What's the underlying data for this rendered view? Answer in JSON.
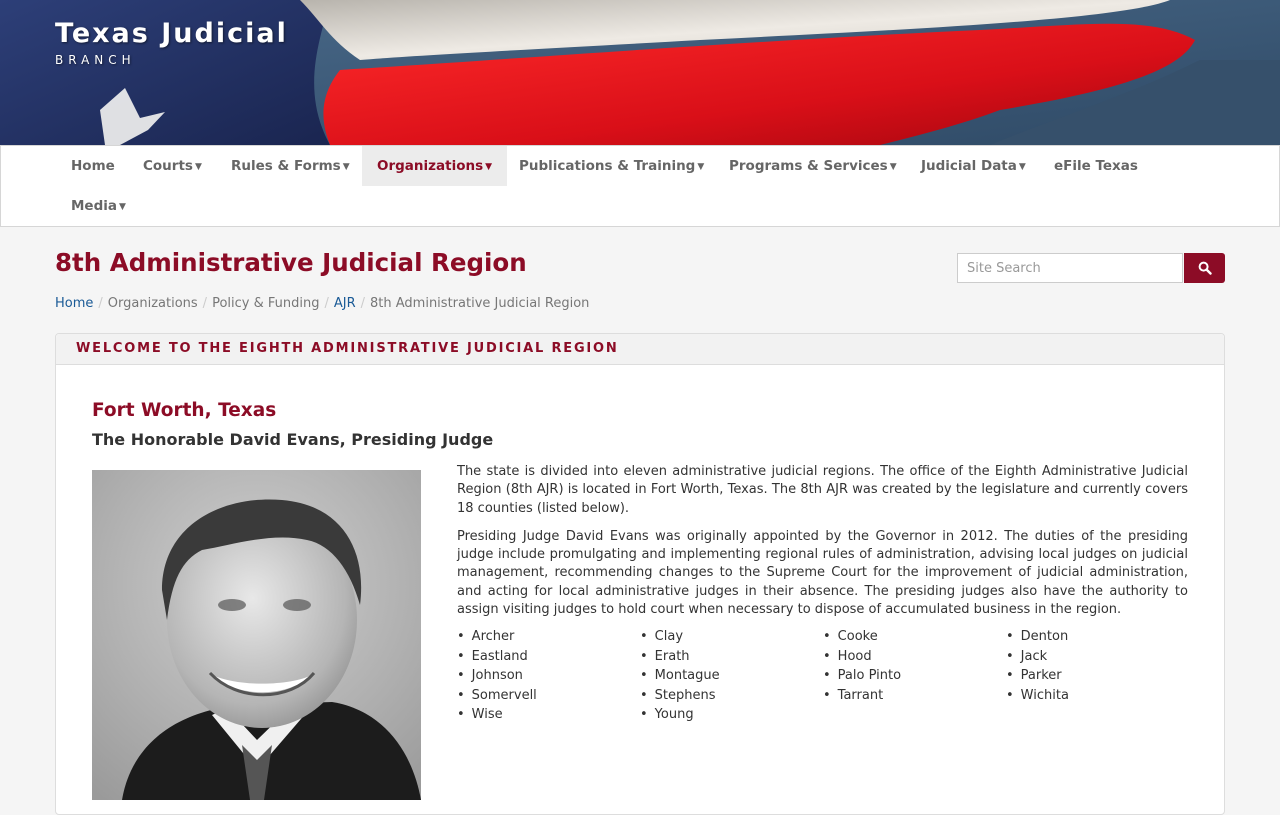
{
  "brand": {
    "title": "Texas Judicial",
    "subtitle": "BRANCH"
  },
  "nav": {
    "items": [
      {
        "label": "Home",
        "dropdown": false
      },
      {
        "label": "Courts",
        "dropdown": true
      },
      {
        "label": "Rules & Forms",
        "dropdown": true
      },
      {
        "label": "Organizations",
        "dropdown": true,
        "active": true
      },
      {
        "label": "Publications & Training",
        "dropdown": true
      },
      {
        "label": "Programs & Services",
        "dropdown": true
      },
      {
        "label": "Judicial Data",
        "dropdown": true
      },
      {
        "label": "eFile Texas",
        "dropdown": false
      },
      {
        "label": "Media",
        "dropdown": true
      }
    ]
  },
  "page": {
    "title": "8th Administrative Judicial Region"
  },
  "search": {
    "placeholder": "Site Search",
    "icon": "search-icon"
  },
  "breadcrumb": [
    {
      "label": "Home",
      "link": true
    },
    {
      "label": "Organizations",
      "link": false
    },
    {
      "label": "Policy & Funding",
      "link": false
    },
    {
      "label": "AJR",
      "link": true
    },
    {
      "label": "8th Administrative Judicial Region",
      "link": false
    }
  ],
  "panel": {
    "heading": "WELCOME TO THE EIGHTH ADMINISTRATIVE JUDICIAL REGION",
    "city": "Fort Worth, Texas",
    "judge": "The Honorable David Evans, Presiding Judge",
    "paragraphs": [
      "The state is divided into eleven administrative judicial regions. The office of the Eighth Administrative Judicial Region (8th AJR) is located in Fort Worth, Texas. The 8th AJR was created by the legislature and currently covers 18 counties (listed below).",
      "Presiding Judge David Evans was originally appointed by the Governor in 2012. The duties of the presiding judge include promulgating and implementing regional rules of administration, advising local judges on judicial management, recommending changes to the Supreme Court for the improvement of judicial administration, and acting for local administrative judges in their absence. The presiding judges also have the authority to assign visiting judges to hold court when necessary to dispose of accumulated business in the region."
    ],
    "counties": [
      "Archer",
      "Clay",
      "Cooke",
      "Denton",
      "Eastland",
      "Erath",
      "Hood",
      "Jack",
      "Johnson",
      "Montague",
      "Palo Pinto",
      "Parker",
      "Somervell",
      "Stephens",
      "Tarrant",
      "Wichita",
      "Wise",
      "Young"
    ]
  },
  "colors": {
    "accent": "#8c0c26",
    "link": "#1a5a96",
    "flag_red": "#e0141e",
    "flag_blue": "#23325f"
  }
}
